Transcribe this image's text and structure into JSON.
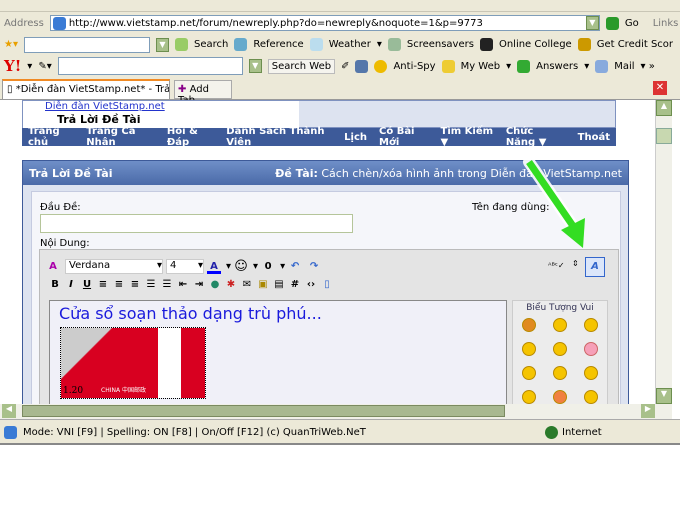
{
  "address": {
    "label": "Address",
    "url": "http://www.vietstamp.net/forum/newreply.php?do=newreply&noquote=1&p=9773",
    "go": "Go",
    "links": "Links"
  },
  "toolbar2": {
    "items": [
      "Search",
      "Reference",
      "Weather",
      "Screensavers",
      "Online College",
      "Get Credit Scor"
    ]
  },
  "yahoo": {
    "logo": "Y!",
    "search_web": "Search Web",
    "items": [
      "Anti-Spy",
      "My Web",
      "Answers",
      "Mail"
    ]
  },
  "tabs": {
    "active": "*Diễn đàn VietStamp.net* - Trả ...",
    "add": "Add Tab"
  },
  "breadcrumb": {
    "parent": "Diễn đàn VietStamp.net",
    "current": "Trả Lời Đề Tài"
  },
  "nav": [
    "Trang chủ",
    "Trang Cá Nhân",
    "Hỏi & Đáp",
    "Danh Sách Thành Viên",
    "Lịch",
    "Có Bài Mới",
    "Tìm Kiếm ▼",
    "Chức Năng ▼",
    "Thoát"
  ],
  "panel": {
    "title": "Trả Lời Đề Tài",
    "topic_label": "Đề Tài:",
    "topic": "Cách chèn/xóa hình ảnh trong Diễn đàn VietStamp.net",
    "subject_label": "Đầu Đề:",
    "subject_value": "",
    "username_label": "Tên đang dùng:",
    "content_label": "Nội Dung:"
  },
  "editor": {
    "font": "Verdana",
    "size": "4",
    "text": "Cửa sổ soạn thảo dạng trù phú...",
    "smilies_title": "Biểu Tượng Vui",
    "stamp_value": "1.20",
    "stamp_country": "CHINA 中国邮政"
  },
  "status": {
    "text": "Mode: VNI [F9] | Spelling: ON [F8] | On/Off [F12] (c) QuanTriWeb.NeT",
    "zone": "Internet"
  },
  "colors": {
    "nav": "#3d5a99",
    "header": "#5a7ab8",
    "arrow": "#33dd22"
  }
}
